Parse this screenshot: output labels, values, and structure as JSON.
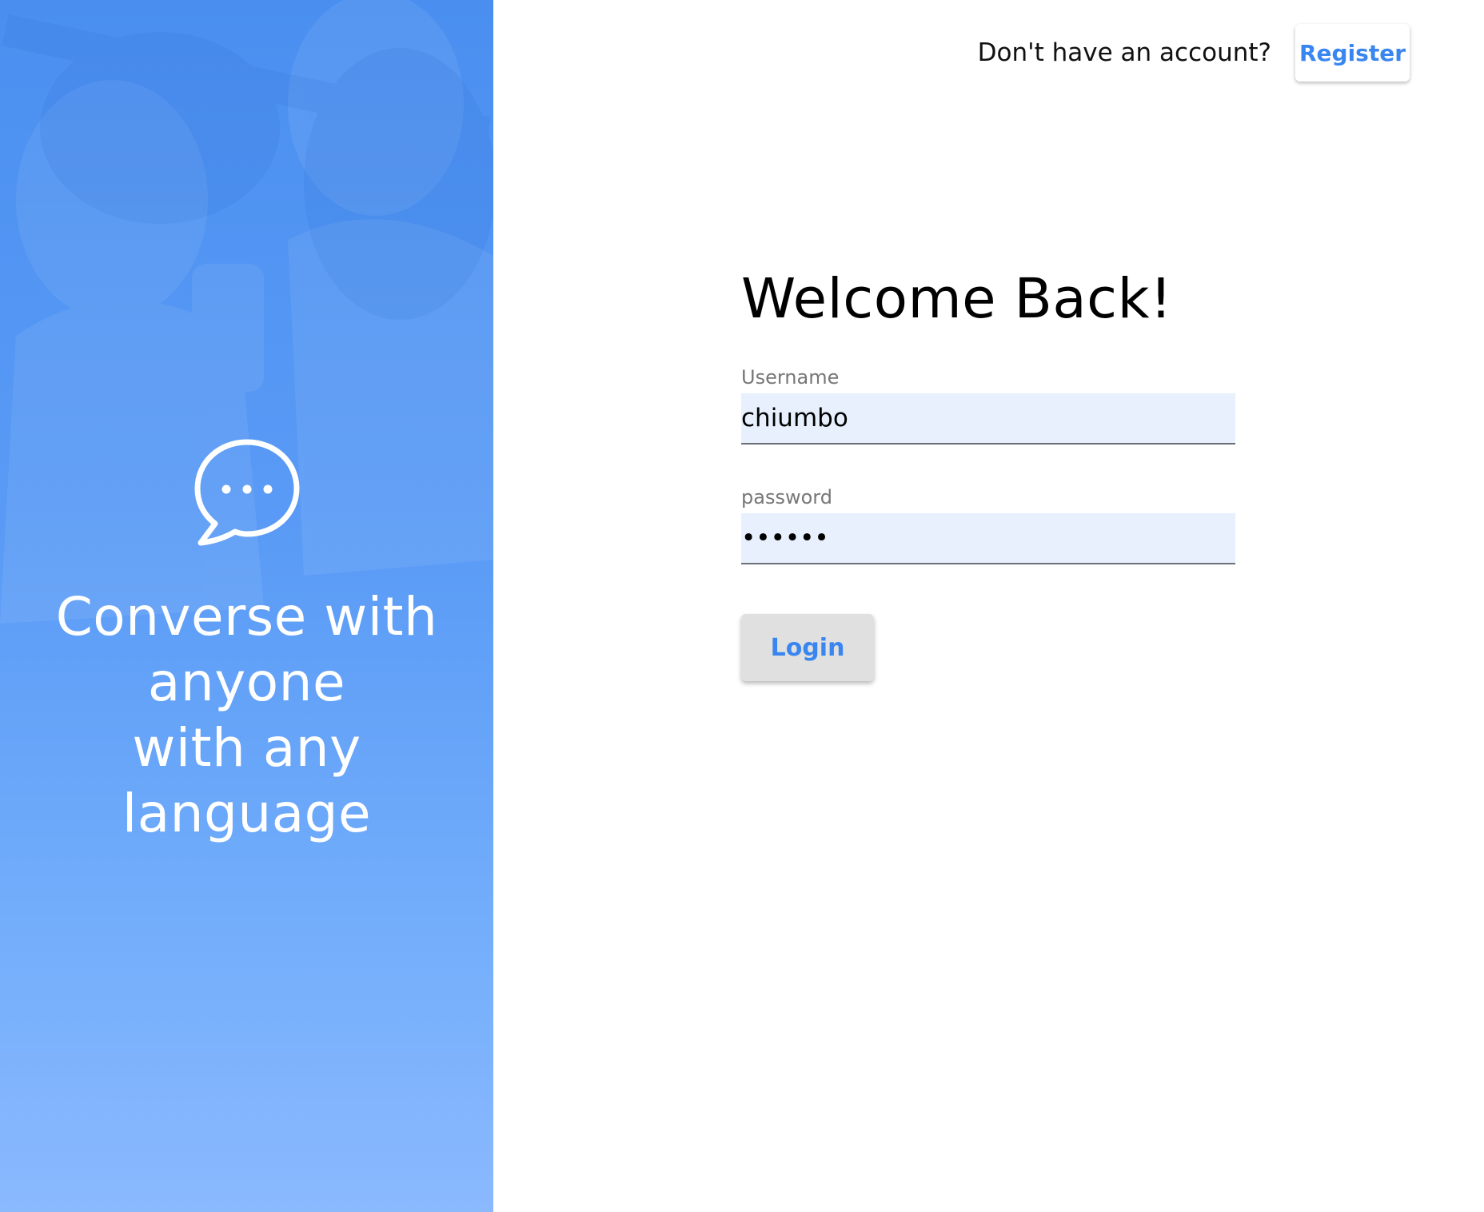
{
  "hero": {
    "icon": "chat-bubble-icon",
    "tagline_lines": [
      "Converse with",
      "anyone",
      "with any language"
    ],
    "overlay_color": "#4a8ff0"
  },
  "topbar": {
    "prompt": "Don't have an account?",
    "register_label": "Register"
  },
  "form": {
    "title": "Welcome Back!",
    "username": {
      "label": "Username",
      "value": "chiumbo"
    },
    "password": {
      "label": "password",
      "value": "••••••"
    },
    "login_label": "Login"
  },
  "colors": {
    "accent": "#3a86f0",
    "input_bg": "#e8f0fe",
    "button_grey": "#e0e0e0"
  }
}
